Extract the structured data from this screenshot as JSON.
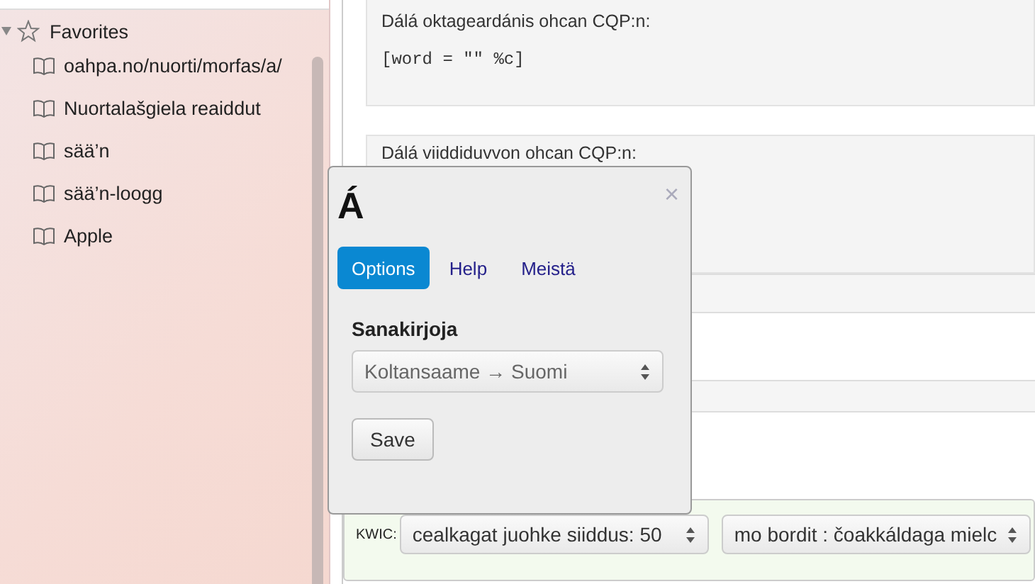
{
  "sidebar": {
    "section": {
      "label": "Favorites"
    },
    "items": [
      {
        "label": "oahpa.no/nuorti/morfas/a/"
      },
      {
        "label": "Nuortalašgiela reaiddut"
      },
      {
        "label": "sää’n"
      },
      {
        "label": "sää’n-loogg"
      },
      {
        "label": "Apple"
      }
    ]
  },
  "cards": [
    {
      "label": "Dálá oktageardánis ohcan CQP:n:",
      "code": "[word = \"\" %c]"
    },
    {
      "label": "Dálá viiddiduvvon ohcan CQP:n:"
    }
  ],
  "kwic": {
    "label": "KWIC:",
    "selects": [
      "cealkagat juohke siiddus: 50",
      "mo bordit : čoakkáldaga mielc"
    ]
  },
  "popup": {
    "title": "Á",
    "close": "×",
    "tabs": [
      {
        "label": "Options",
        "selected": true
      },
      {
        "label": "Help",
        "selected": false
      },
      {
        "label": "Meistä",
        "selected": false
      }
    ],
    "field_label": "Sanakirjoja",
    "select": "Koltansaame → Suomi",
    "save": "Save"
  }
}
